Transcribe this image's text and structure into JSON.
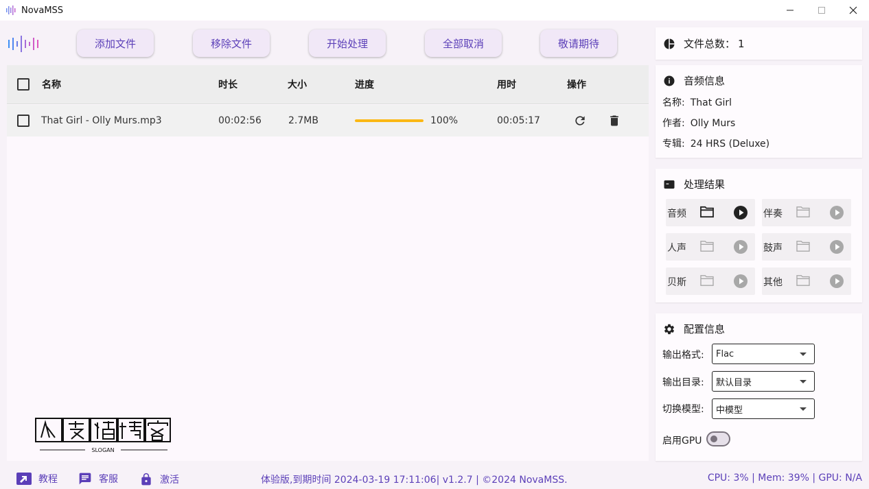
{
  "window": {
    "title": "NovaMSS"
  },
  "toolbar": {
    "buttons": [
      {
        "label": "添加文件"
      },
      {
        "label": "移除文件"
      },
      {
        "label": "开始处理"
      },
      {
        "label": "全部取消"
      },
      {
        "label": "敬请期待"
      }
    ]
  },
  "file_list": {
    "columns": [
      "名称",
      "时长",
      "大小",
      "进度",
      "用时",
      "操作"
    ],
    "rows": [
      {
        "name": "That Girl - Olly Murs.mp3",
        "duration": "00:02:56",
        "size": "2.7MB",
        "progress": 100,
        "progress_text": "100%",
        "elapsed": "00:05:17"
      }
    ]
  },
  "file_count": {
    "label": "文件总数：",
    "value": "1"
  },
  "audio_info": {
    "title": "音频信息",
    "name_label": "名称:",
    "name": "That Girl",
    "artist_label": "作者:",
    "artist": "Olly Murs",
    "album_label": "专辑:",
    "album": "24 HRS (Deluxe)"
  },
  "results": {
    "title": "处理结果",
    "items": [
      {
        "label": "音频",
        "active": true
      },
      {
        "label": "伴奏",
        "active": false
      },
      {
        "label": "人声",
        "active": false
      },
      {
        "label": "鼓声",
        "active": false
      },
      {
        "label": "贝斯",
        "active": false
      },
      {
        "label": "其他",
        "active": false
      }
    ]
  },
  "config": {
    "title": "配置信息",
    "format_label": "输出格式:",
    "format_value": "Flac",
    "dir_label": "输出目录:",
    "dir_value": "默认目录",
    "model_label": "切换模型:",
    "model_value": "中模型",
    "gpu_label": "启用GPU",
    "gpu_enabled": false
  },
  "statusbar": {
    "tutorial": "教程",
    "support": "客服",
    "activate": "激活",
    "center": "体验版,到期时间 2024-03-19 17:11:06| v1.2.7 | ©2024 NovaMSS.",
    "right": "CPU: 3% | Mem: 39% | GPU: N/A"
  },
  "colors": {
    "accent": "#5b3fb8",
    "progress": "#fbb814",
    "button_bg": "#f1e8f7"
  }
}
